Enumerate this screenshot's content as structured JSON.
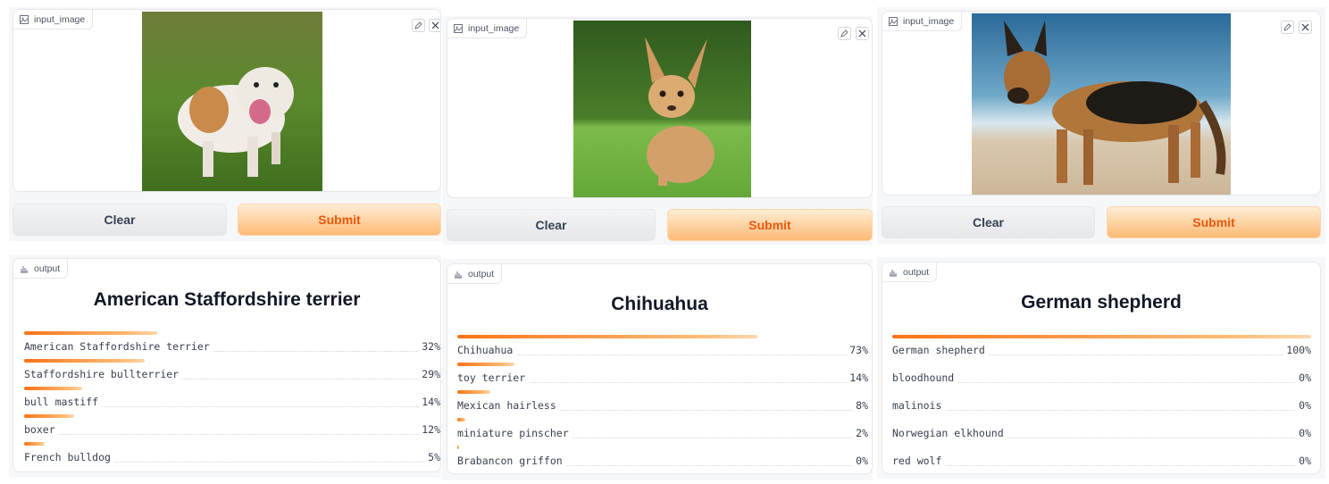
{
  "tag_input": "input_image",
  "tag_output": "output",
  "clear_label": "Clear",
  "submit_label": "Submit",
  "colors": {
    "accent": "#f97316",
    "submit_text": "#ea580c"
  },
  "panels": [
    {
      "title": "American Staffordshire terrier",
      "rows": [
        {
          "label": "American Staffordshire terrier",
          "pct": "32%",
          "value": 0.32
        },
        {
          "label": "Staffordshire bullterrier",
          "pct": "29%",
          "value": 0.29
        },
        {
          "label": "bull mastiff",
          "pct": "14%",
          "value": 0.14
        },
        {
          "label": "boxer",
          "pct": "12%",
          "value": 0.12
        },
        {
          "label": "French bulldog",
          "pct": "5%",
          "value": 0.05
        }
      ]
    },
    {
      "title": "Chihuahua",
      "rows": [
        {
          "label": "Chihuahua",
          "pct": "73%",
          "value": 0.73
        },
        {
          "label": "toy terrier",
          "pct": "14%",
          "value": 0.14
        },
        {
          "label": "Mexican hairless",
          "pct": "8%",
          "value": 0.08
        },
        {
          "label": "miniature pinscher",
          "pct": "2%",
          "value": 0.02
        },
        {
          "label": "Brabancon griffon",
          "pct": "0%",
          "value": 0.003
        }
      ]
    },
    {
      "title": "German shepherd",
      "rows": [
        {
          "label": "German shepherd",
          "pct": "100%",
          "value": 1.0
        },
        {
          "label": "bloodhound",
          "pct": "0%",
          "value": 0
        },
        {
          "label": "malinois",
          "pct": "0%",
          "value": 0
        },
        {
          "label": "Norwegian elkhound",
          "pct": "0%",
          "value": 0
        },
        {
          "label": "red wolf",
          "pct": "0%",
          "value": 0
        }
      ]
    }
  ]
}
